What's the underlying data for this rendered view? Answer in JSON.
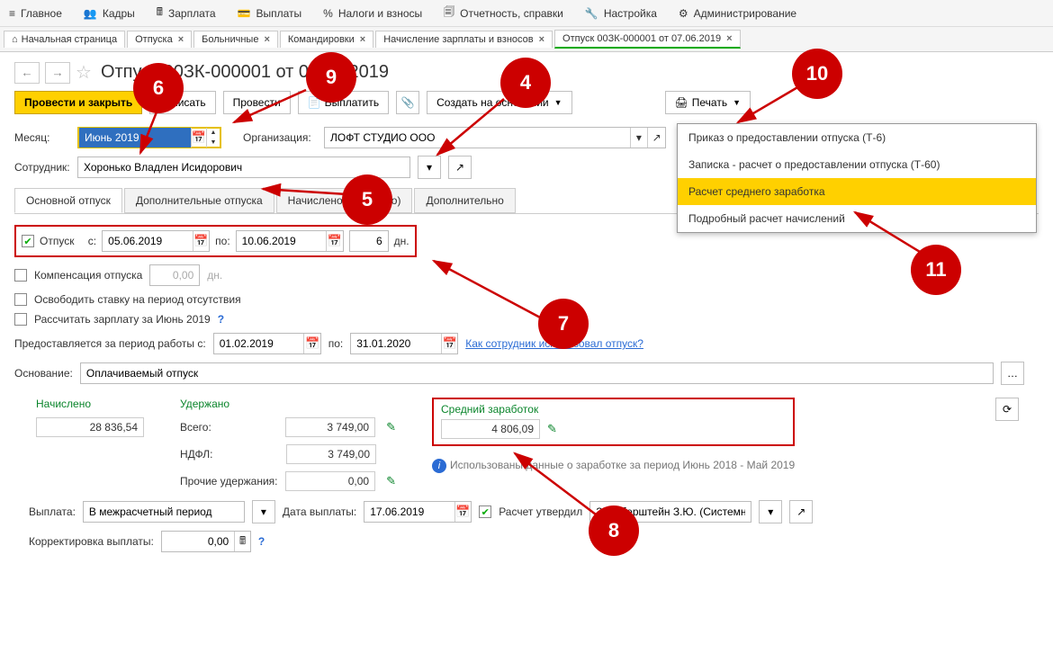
{
  "top_menu": [
    {
      "id": "main",
      "label": "Главное"
    },
    {
      "id": "staff",
      "label": "Кадры"
    },
    {
      "id": "salary",
      "label": "Зарплата"
    },
    {
      "id": "payouts",
      "label": "Выплаты"
    },
    {
      "id": "taxes",
      "label": "Налоги и взносы"
    },
    {
      "id": "reports",
      "label": "Отчетность, справки"
    },
    {
      "id": "settings",
      "label": "Настройка"
    },
    {
      "id": "admin",
      "label": "Администрирование"
    }
  ],
  "tabs": [
    {
      "id": "start",
      "label": "Начальная страница",
      "home": true
    },
    {
      "id": "vacations",
      "label": "Отпуска"
    },
    {
      "id": "sick",
      "label": "Больничные"
    },
    {
      "id": "trips",
      "label": "Командировки"
    },
    {
      "id": "payroll",
      "label": "Начисление зарплаты и взносов"
    },
    {
      "id": "doc",
      "label": "Отпуск 00ЗК-000001 от 07.06.2019",
      "active": true
    }
  ],
  "doc": {
    "title": "Отпуск 00ЗК-000001 от 07.06.2019",
    "toolbar": {
      "post_close": "Провести и закрыть",
      "save": "Записать",
      "post": "Провести",
      "pay": "Выплатить",
      "create_based": "Создать на основании",
      "print": "Печать"
    },
    "print_menu": [
      "Приказ о предоставлении отпуска (Т-6)",
      "Записка - расчет о предоставлении отпуска (Т-60)",
      "Расчет среднего заработка",
      "Подробный расчет начислений"
    ],
    "month_label": "Месяц:",
    "month_value": "Июнь 2019",
    "org_label": "Организация:",
    "org_value": "ЛОФТ СТУДИО ООО",
    "employee_label": "Сотрудник:",
    "employee_value": "Хоронько Владлен Исидорович"
  },
  "subtabs": [
    "Основной отпуск",
    "Дополнительные отпуска",
    "Начислено (подробно)",
    "Дополнительно"
  ],
  "main_tab": {
    "vac_chk": "Отпуск",
    "from_lbl": "с:",
    "from_val": "05.06.2019",
    "to_lbl": "по:",
    "to_val": "10.06.2019",
    "days_val": "6",
    "days_lbl": "дн.",
    "comp_lbl": "Компенсация отпуска",
    "comp_val": "0,00",
    "comp_unit": "дн.",
    "free_rate": "Освободить ставку на период отсутствия",
    "recalc": "Рассчитать зарплату за Июнь 2019",
    "period_lbl": "Предоставляется за период работы с:",
    "period_from": "01.02.2019",
    "period_to_lbl": "по:",
    "period_to": "31.01.2020",
    "how_link": "Как сотрудник использовал отпуск?",
    "basis_lbl": "Основание:",
    "basis_val": "Оплачиваемый отпуск"
  },
  "totals": {
    "accrued_lbl": "Начислено",
    "accrued_val": "28 836,54",
    "withheld_lbl": "Удержано",
    "total_lbl": "Всего:",
    "total_val": "3 749,00",
    "ndfl_lbl": "НДФЛ:",
    "ndfl_val": "3 749,00",
    "other_lbl": "Прочие удержания:",
    "other_val": "0,00",
    "avg_lbl": "Средний заработок",
    "avg_val": "4 806,09",
    "avg_note": "Использованы данные о заработке за период Июнь 2018 - Май 2019"
  },
  "payout": {
    "pay_lbl": "Выплата:",
    "pay_val": "В межрасчетный период",
    "date_lbl": "Дата выплаты:",
    "date_val": "17.06.2019",
    "approved_lbl": "Расчет утвердил",
    "approver": "Зильберштейн З.Ю. (Системный п",
    "corr_lbl": "Корректировка выплаты:",
    "corr_val": "0,00"
  },
  "badges": {
    "4": "4",
    "5": "5",
    "6": "6",
    "7": "7",
    "8": "8",
    "9": "9",
    "10": "10",
    "11": "11"
  }
}
